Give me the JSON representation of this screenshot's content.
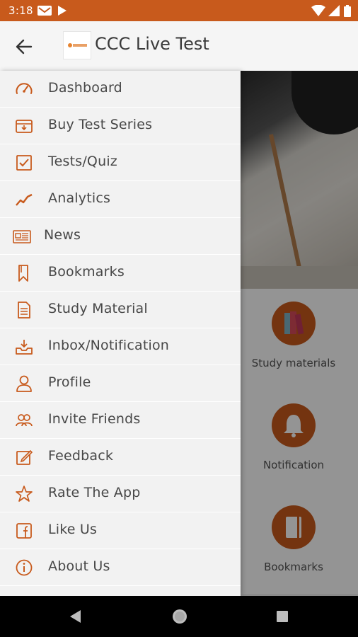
{
  "status_bar": {
    "time": "3:18"
  },
  "app_bar": {
    "title": "CCC Live Test",
    "logo_text": "OLIVEBOARD"
  },
  "drawer": {
    "items": [
      {
        "label": "Dashboard",
        "icon": "dashboard-gauge-icon"
      },
      {
        "label": "Buy Test Series",
        "icon": "buy-box-icon"
      },
      {
        "label": "Tests/Quiz",
        "icon": "test-checklist-icon"
      },
      {
        "label": "Analytics",
        "icon": "analytics-line-icon"
      },
      {
        "label": "News",
        "icon": "newspaper-icon"
      },
      {
        "label": "Bookmarks",
        "icon": "bookmark-icon"
      },
      {
        "label": "Study Material",
        "icon": "document-icon"
      },
      {
        "label": "Inbox/Notification",
        "icon": "inbox-icon"
      },
      {
        "label": "Profile",
        "icon": "person-icon"
      },
      {
        "label": "Invite Friends",
        "icon": "group-icon"
      },
      {
        "label": "Feedback",
        "icon": "edit-icon"
      },
      {
        "label": "Rate The App",
        "icon": "star-icon"
      },
      {
        "label": "Like Us",
        "icon": "facebook-icon"
      },
      {
        "label": "About Us",
        "icon": "info-icon"
      }
    ]
  },
  "background": {
    "cards": [
      {
        "label": "Study materials",
        "icon": "books-icon"
      },
      {
        "label": "Notification",
        "icon": "bell-icon"
      },
      {
        "label": "Bookmarks",
        "icon": "bookmark-book-icon"
      }
    ]
  },
  "colors": {
    "accent": "#c85a1c",
    "drawer_bg": "#f2f2f2",
    "text": "#474747"
  }
}
